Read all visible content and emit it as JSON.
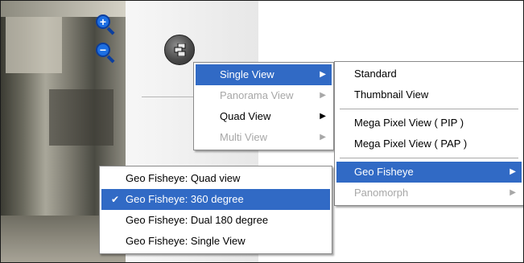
{
  "main_menu": {
    "items": [
      {
        "label": "Single View",
        "state": "selected",
        "has_submenu": true
      },
      {
        "label": "Panorama View",
        "state": "disabled",
        "has_submenu": true
      },
      {
        "label": "Quad View",
        "state": "normal",
        "has_submenu": true
      },
      {
        "label": "Multi View",
        "state": "disabled",
        "has_submenu": true
      }
    ]
  },
  "single_view_submenu": {
    "items": [
      {
        "label": "Standard",
        "state": "normal"
      },
      {
        "label": "Thumbnail View",
        "state": "normal"
      },
      {
        "label": "Mega Pixel View ( PIP )",
        "state": "normal"
      },
      {
        "label": "Mega Pixel View ( PAP )",
        "state": "normal"
      },
      {
        "label": "Geo Fisheye",
        "state": "selected",
        "has_submenu": true
      },
      {
        "label": "Panomorph",
        "state": "disabled",
        "has_submenu": true
      }
    ]
  },
  "geo_fisheye_submenu": {
    "items": [
      {
        "label": "Geo Fisheye: Quad view",
        "state": "normal",
        "checked": false
      },
      {
        "label": "Geo Fisheye: 360 degree",
        "state": "selected",
        "checked": true
      },
      {
        "label": "Geo Fisheye: Dual 180 degree",
        "state": "normal",
        "checked": false
      },
      {
        "label": "Geo Fisheye: Single View",
        "state": "normal",
        "checked": false
      }
    ]
  },
  "icons": {
    "zoom_in": "zoom-in-icon",
    "zoom_out": "zoom-out-icon",
    "view_mode": "view-mode-icon",
    "submenu_arrow": "▶",
    "check": "✔"
  },
  "colors": {
    "selection": "#316ac5",
    "disabled_text": "#a7a7a7",
    "zoom_blue": "#1d6fe3"
  }
}
